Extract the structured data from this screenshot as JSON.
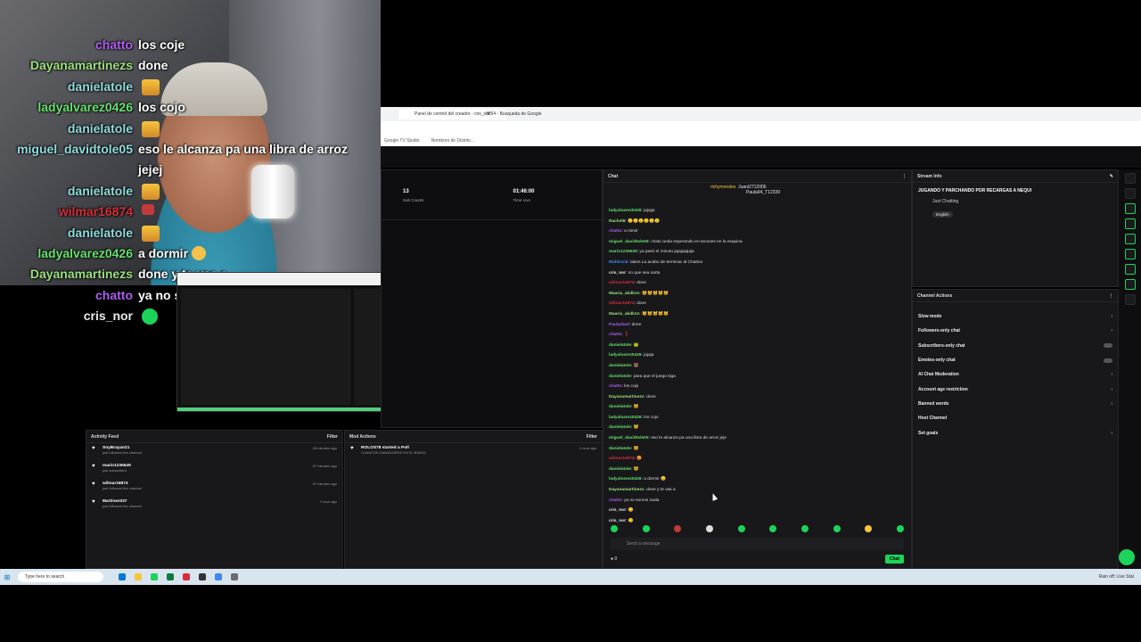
{
  "overlay_chat": [
    {
      "user": "chatto",
      "color": "#b05cf0",
      "msg": "los coje",
      "emote": ""
    },
    {
      "user": "Dayanamartinezs",
      "color": "#9be07a",
      "msg": "done",
      "emote": ""
    },
    {
      "user": "danielatole",
      "color": "#8fdcdc",
      "msg": "",
      "emote": "gold"
    },
    {
      "user": "ladyalvarez0426",
      "color": "#63e06b",
      "msg": "los cojo",
      "emote": ""
    },
    {
      "user": "danielatole",
      "color": "#8fdcdc",
      "msg": "",
      "emote": "gold"
    },
    {
      "user": "miguel_davidtole05",
      "color": "#8fdcdc",
      "msg": "eso le alcanza pa una libra de arroz",
      "emote": ""
    },
    {
      "user": "",
      "color": "#fff",
      "msg": "jejej",
      "emote": ""
    },
    {
      "user": "danielatole",
      "color": "#8fdcdc",
      "msg": "",
      "emote": "gold"
    },
    {
      "user": "wilmar16874",
      "color": "#d62d3a",
      "msg": "",
      "emote": "red"
    },
    {
      "user": "danielatole",
      "color": "#8fdcdc",
      "msg": "",
      "emote": "gold"
    },
    {
      "user": "ladyalvarez0426",
      "color": "#63e06b",
      "msg": "a dormir",
      "emote": "sad"
    },
    {
      "user": "Dayanamartinezs",
      "color": "#9be07a",
      "msg": "done y te vas a",
      "emote": ""
    },
    {
      "user": "chatto",
      "color": "#b05cf0",
      "msg": "ya no somos nada",
      "emote": ""
    },
    {
      "user": "cris_nor",
      "color": "#eaeaea",
      "msg": "",
      "emote": "green"
    }
  ],
  "browser": {
    "tabs": [
      "Panel de control del creador - cris_nor",
      "3054 - Búsqueda de Google"
    ],
    "bookmarks": [
      "Google TV Studio",
      "Nombres de Distrito..."
    ]
  },
  "stats": {
    "sub_count_value": "13",
    "sub_count_label": "Sub Counts",
    "time_live_value": "01:46:00",
    "time_live_label": "Time Live"
  },
  "chat": {
    "title": "Chat",
    "goal_user_1": "richymendes",
    "goal_user_2": "Juani2712006",
    "goal_user_3": "Paula94_T12339",
    "lines": [
      {
        "u": "ladyalvarez0426",
        "c": "#63e06b",
        "m": "jajajja"
      },
      {
        "u": "Rachel8",
        "c": "#9be07a",
        "m": "🙂🙂🙂🙂🙂🙂"
      },
      {
        "u": "chatto",
        "c": "#b05cf0",
        "m": "a mimir"
      },
      {
        "u": "miguel_davidtole05",
        "c": "#63e06b",
        "m": "chato anda esperando en tacones en la esquina"
      },
      {
        "u": "mario1236549",
        "c": "#63e06b",
        "m": "ya pasó el minuto jajajajajaja"
      },
      {
        "u": "Moldrock",
        "c": "#3d8bf0",
        "m": "takes La acabo de terminar al Chattoo"
      },
      {
        "u": "cris_nor",
        "c": "#eaeaea",
        "m": "no que sea sarta"
      },
      {
        "u": "wilmar16874",
        "c": "#d62d3a",
        "m": "done"
      },
      {
        "u": "Maaria_akdk1n",
        "c": "#9be07a",
        "m": "🐱🐱🐱🐱🐱"
      },
      {
        "u": "wilmar16874",
        "c": "#d62d3a",
        "m": "done"
      },
      {
        "u": "Maaria_akdk1n",
        "c": "#9be07a",
        "m": "🐱🐱🐱🐱🐱"
      },
      {
        "u": "Paulyduol",
        "c": "#b05cf0",
        "m": "done"
      },
      {
        "u": "chatto",
        "c": "#b05cf0",
        "m": "❗"
      },
      {
        "u": "danielatole",
        "c": "#63e06b",
        "m": "🐸"
      },
      {
        "u": "ladyalvarez0426",
        "c": "#63e06b",
        "m": "jajaja"
      },
      {
        "u": "danielatole",
        "c": "#63e06b",
        "m": "🐻"
      },
      {
        "u": "danielatole",
        "c": "#63e06b",
        "m": "para que el juego siga"
      },
      {
        "u": "chatto",
        "c": "#b05cf0",
        "m": "los cojo"
      },
      {
        "u": "Dayanamartinezs",
        "c": "#9be07a",
        "m": "done"
      },
      {
        "u": "danielatole",
        "c": "#63e06b",
        "m": "🐱"
      },
      {
        "u": "ladyalvarez0426",
        "c": "#63e06b",
        "m": "los cojo"
      },
      {
        "u": "danielatole",
        "c": "#63e06b",
        "m": "🐱"
      },
      {
        "u": "miguel_davidtole05",
        "c": "#63e06b",
        "m": "eso le alcanza pa una libra de arroz jeje"
      },
      {
        "u": "danielatole",
        "c": "#63e06b",
        "m": "🐱"
      },
      {
        "u": "wilmar16874",
        "c": "#d62d3a",
        "m": "😡"
      },
      {
        "u": "danielatole",
        "c": "#63e06b",
        "m": "🐱"
      },
      {
        "u": "ladyalvarez0426",
        "c": "#63e06b",
        "m": "a dormir 😞"
      },
      {
        "u": "Dayanamartinezs",
        "c": "#9be07a",
        "m": "done y te vas a"
      },
      {
        "u": "chatto",
        "c": "#b05cf0",
        "m": "ya no somos nada"
      },
      {
        "u": "cris_nor",
        "c": "#eaeaea",
        "m": "🙂"
      },
      {
        "u": "cris_nor",
        "c": "#eaeaea",
        "m": "🙂"
      }
    ],
    "input_placeholder": "Send a message",
    "points": "0",
    "send_label": "Chat"
  },
  "stream_info": {
    "title_label": "Stream Info",
    "stream_title": "JUGANDO Y PARCHANDO POR RECARGAS A NEQUI",
    "category": "Just Chatting",
    "tag": "English"
  },
  "channel_actions": {
    "title": "Channel Actions",
    "items": [
      {
        "label": "Slow mode",
        "control": "chev"
      },
      {
        "label": "Followers-only chat",
        "control": "chev"
      },
      {
        "label": "Subscribers-only chat",
        "control": "toggle"
      },
      {
        "label": "Emotes-only chat",
        "control": "toggle"
      },
      {
        "label": "AI Chat Moderation",
        "control": "chev"
      },
      {
        "label": "Account age restriction",
        "control": "chev"
      },
      {
        "label": "Banned words",
        "control": "chev"
      },
      {
        "label": "Host Channel",
        "control": "none"
      },
      {
        "label": "Set goals",
        "control": "chev"
      }
    ]
  },
  "activity_feed": {
    "title": "Activity Feed",
    "filter": "Filter",
    "items": [
      {
        "name": "SoyBrayan21",
        "sub": "just followed the channel",
        "time": "28 minutes ago"
      },
      {
        "name": "mario1236549",
        "sub": "just subscribed",
        "time": "57 minutes ago"
      },
      {
        "name": "wilmar16874",
        "sub": "just followed the channel",
        "time": "57 minutes ago"
      },
      {
        "name": "Martinez037",
        "sub": "just followed the channel",
        "time": "1 hour ago"
      }
    ]
  },
  "mod_actions": {
    "title": "Mod Actions",
    "filter": "Filter",
    "items": [
      {
        "name": "ROLOS78 started a Poll",
        "sub": "CUANTOS GANADORES EN EL BINGO",
        "time": "1 hour ago"
      }
    ]
  },
  "taskbar": {
    "search_placeholder": "Type here to search",
    "tray": "Rain off; Live Stat"
  }
}
